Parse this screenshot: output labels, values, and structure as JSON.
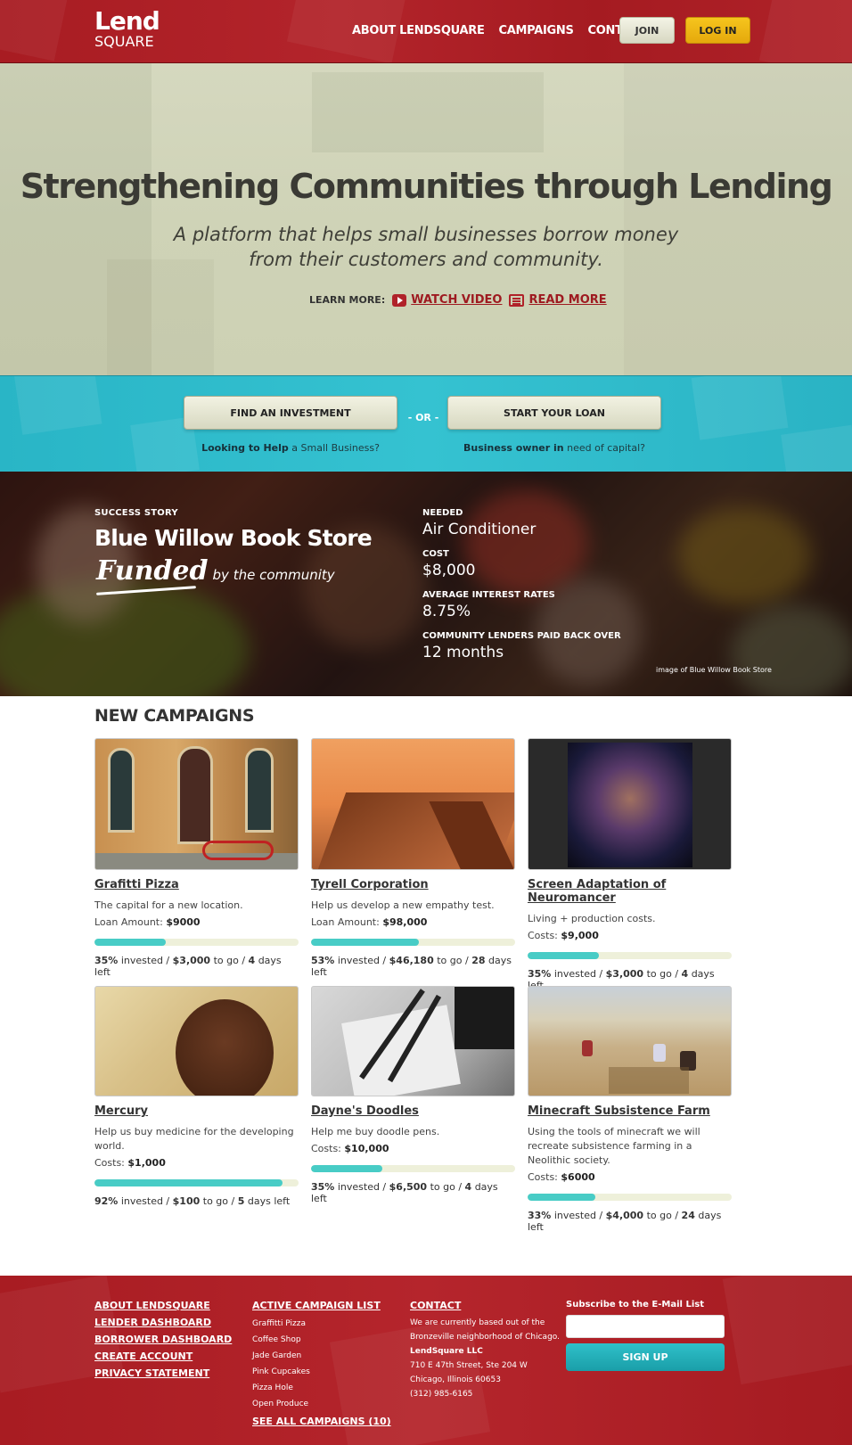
{
  "header": {
    "logo_line1": "Lend",
    "logo_line2": "SQUARE",
    "nav": [
      "ABOUT LENDSQUARE",
      "CAMPAIGNS",
      "CONTACT"
    ],
    "join_label": "JOIN",
    "login_label": "LOG IN"
  },
  "hero": {
    "title": "Strengthening Communities through Lending",
    "subtitle": "A platform that helps small businesses borrow money from their customers and community.",
    "learn_more_label": "LEARN MORE:",
    "watch_video_label": "WATCH VIDEO",
    "read_more_label": "READ MORE"
  },
  "cta": {
    "find_label": "FIND AN INVESTMENT",
    "or_label": "- OR -",
    "start_label": "START YOUR LOAN",
    "find_caption_bold": "Looking to Help",
    "find_caption_rest": " a Small Business?",
    "start_caption_bold": "Business owner in",
    "start_caption_rest": " need of capital?"
  },
  "story": {
    "kicker": "SUCCESS STORY",
    "title": "Blue Willow Book Store",
    "funded": "Funded",
    "by": "by the community",
    "needed_label": "NEEDED",
    "needed_value": "Air Conditioner",
    "cost_label": "COST",
    "cost_value": "$8,000",
    "rate_label": "AVERAGE INTEREST RATES",
    "rate_value": "8.75%",
    "payback_label": "COMMUNITY LENDERS PAID BACK OVER",
    "payback_value": "12 months",
    "credit": "image of Blue Willow Book Store"
  },
  "campaigns": {
    "title": "NEW CAMPAIGNS",
    "items": [
      {
        "name": "Grafitti Pizza",
        "desc": "The capital for a new location.",
        "amount_label": "Loan Amount:",
        "amount": "$9000",
        "percent": 35,
        "pct_text": "35%",
        "togo": "$3,000",
        "days": "4",
        "stat_mid": " invested / ",
        "stat_togo": " to go / ",
        "stat_days": " days left"
      },
      {
        "name": "Tyrell Corporation",
        "desc": "Help us develop a new empathy test.",
        "amount_label": "Loan Amount:",
        "amount": "$98,000",
        "percent": 53,
        "pct_text": "53%",
        "togo": "$46,180",
        "days": "28",
        "stat_mid": " invested / ",
        "stat_togo": " to go / ",
        "stat_days": " days left"
      },
      {
        "name": "Screen Adaptation of Neuromancer",
        "desc": "Living + production costs.",
        "amount_label": "Costs:",
        "amount": "$9,000",
        "percent": 35,
        "pct_text": "35%",
        "togo": "$3,000",
        "days": "4",
        "stat_mid": " invested / ",
        "stat_togo": " to go / ",
        "stat_days": " days left"
      },
      {
        "name": "Mercury",
        "desc": "Help us buy medicine for the developing world.",
        "amount_label": "Costs:",
        "amount": "$1,000",
        "percent": 92,
        "pct_text": "92%",
        "togo": "$100",
        "days": "5",
        "stat_mid": " invested / ",
        "stat_togo": " to go / ",
        "stat_days": " days left"
      },
      {
        "name": "Dayne's Doodles",
        "desc": "Help me buy doodle pens.",
        "amount_label": "Costs:",
        "amount": "$10,000",
        "percent": 35,
        "pct_text": "35%",
        "togo": "$6,500",
        "days": "4",
        "stat_mid": " invested / ",
        "stat_togo": " to go / ",
        "stat_days": " days left"
      },
      {
        "name": "Minecraft Subsistence Farm",
        "desc": "Using the tools of minecraft we will recreate subsistence farming in a Neolithic society.",
        "amount_label": "Costs:",
        "amount": "$6000",
        "percent": 33,
        "pct_text": "33%",
        "togo": "$4,000",
        "days": "24",
        "stat_mid": " invested / ",
        "stat_togo": " to go / ",
        "stat_days": " days left"
      }
    ]
  },
  "footer": {
    "links": [
      "ABOUT LENDSQUARE",
      "LENDER DASHBOARD",
      "BORROWER DASHBOARD",
      "CREATE ACCOUNT",
      "PRIVACY STATEMENT"
    ],
    "campaign_list_head": "ACTIVE CAMPAIGN LIST",
    "campaign_list": [
      "Graffitti Pizza",
      "Coffee Shop",
      "Jade Garden",
      "Pink Cupcakes",
      "Pizza Hole",
      "Open Produce"
    ],
    "see_all": "SEE ALL CAMPAIGNS (10)",
    "contact_head": "CONTACT",
    "contact_line1": "We are currently based out of the",
    "contact_line2": "Bronzeville neighborhood of Chicago.",
    "contact_company": "LendSquare LLC",
    "contact_addr1": "710 E 47th Street, Ste 204 W",
    "contact_addr2": "Chicago, Illinois 60653",
    "contact_phone": "(312) 985-6165",
    "subscribe_label": "Subscribe to the E-Mail List",
    "email_value": "",
    "signup_label": "SIGN UP"
  },
  "colors": {
    "brand_red": "#b02229",
    "accent_teal": "#35c2d1",
    "login_yellow": "#f6c51d",
    "progress_fill": "#48ccc6"
  }
}
